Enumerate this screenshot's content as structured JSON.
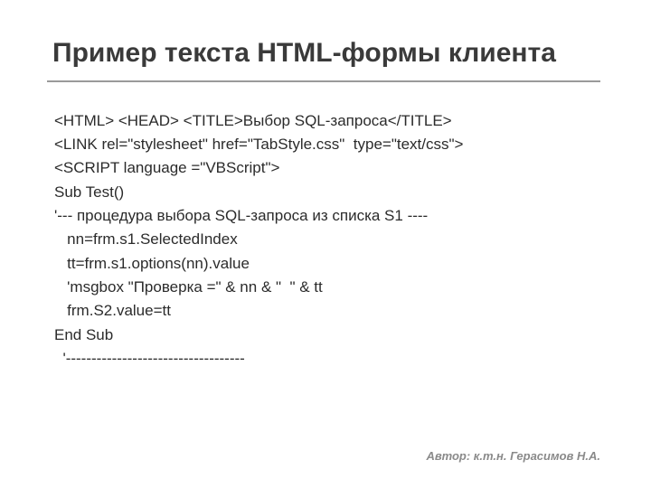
{
  "title": "Пример текста HTML-формы клиента",
  "lines": [
    "<HTML> <HEAD> <TITLE>Выбор SQL-запроса</TITLE>",
    "<LINK rel=\"stylesheet\" href=\"TabStyle.css\"  type=\"text/css\">",
    "<SCRIPT language =\"VBScript\">",
    "Sub Test()",
    "'--- процедура выбора SQL-запроса из списка S1 ----",
    "   nn=frm.s1.SelectedIndex",
    "   tt=frm.s1.options(nn).value",
    "   'msgbox \"Проверка =\" & nn & \"  \" & tt",
    "   frm.S2.value=tt",
    "End Sub",
    "  '-----------------------------------"
  ],
  "author": "Автор: к.т.н. Герасимов Н.А."
}
